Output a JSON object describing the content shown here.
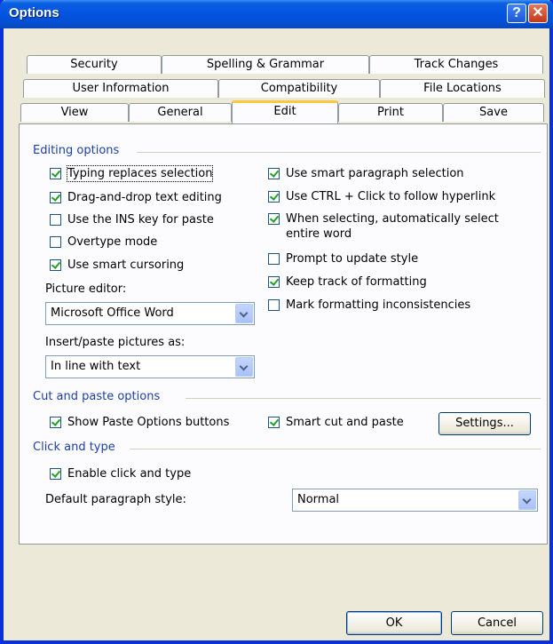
{
  "window": {
    "title": "Options",
    "help_label": "?",
    "close_label": "✕"
  },
  "tabs": {
    "row1": [
      "Security",
      "Spelling & Grammar",
      "Track Changes"
    ],
    "row2": [
      "User Information",
      "Compatibility",
      "File Locations"
    ],
    "row3": [
      "View",
      "General",
      "Edit",
      "Print",
      "Save"
    ],
    "active": "Edit"
  },
  "editing": {
    "group": "Editing options",
    "left": [
      {
        "label": "Typing replaces selection",
        "checked": true
      },
      {
        "label": "Drag-and-drop text editing",
        "checked": true
      },
      {
        "label": "Use the INS key for paste",
        "checked": false
      },
      {
        "label": "Overtype mode",
        "checked": false
      },
      {
        "label": "Use smart cursoring",
        "checked": true
      }
    ],
    "right": [
      {
        "label": "Use smart paragraph selection",
        "checked": true
      },
      {
        "label": "Use CTRL + Click to follow hyperlink",
        "checked": true
      },
      {
        "label": "When selecting, automatically select entire word",
        "checked": true
      },
      {
        "label": "Prompt to update style",
        "checked": false
      },
      {
        "label": "Keep track of formatting",
        "checked": true
      },
      {
        "label": "Mark formatting inconsistencies",
        "checked": false
      }
    ],
    "picture_editor_label": "Picture editor:",
    "picture_editor_value": "Microsoft Office Word",
    "insert_paste_label": "Insert/paste pictures as:",
    "insert_paste_value": "In line with text"
  },
  "cutpaste": {
    "group": "Cut and paste options",
    "show_paste": {
      "label": "Show Paste Options buttons",
      "checked": true
    },
    "smart_cut": {
      "label": "Smart cut and paste",
      "checked": true
    },
    "settings_label": "Settings..."
  },
  "clicktype": {
    "group": "Click and type",
    "enable": {
      "label": "Enable click and type",
      "checked": true
    },
    "default_style_label": "Default paragraph style:",
    "default_style_value": "Normal"
  },
  "buttons": {
    "ok": "OK",
    "cancel": "Cancel"
  }
}
